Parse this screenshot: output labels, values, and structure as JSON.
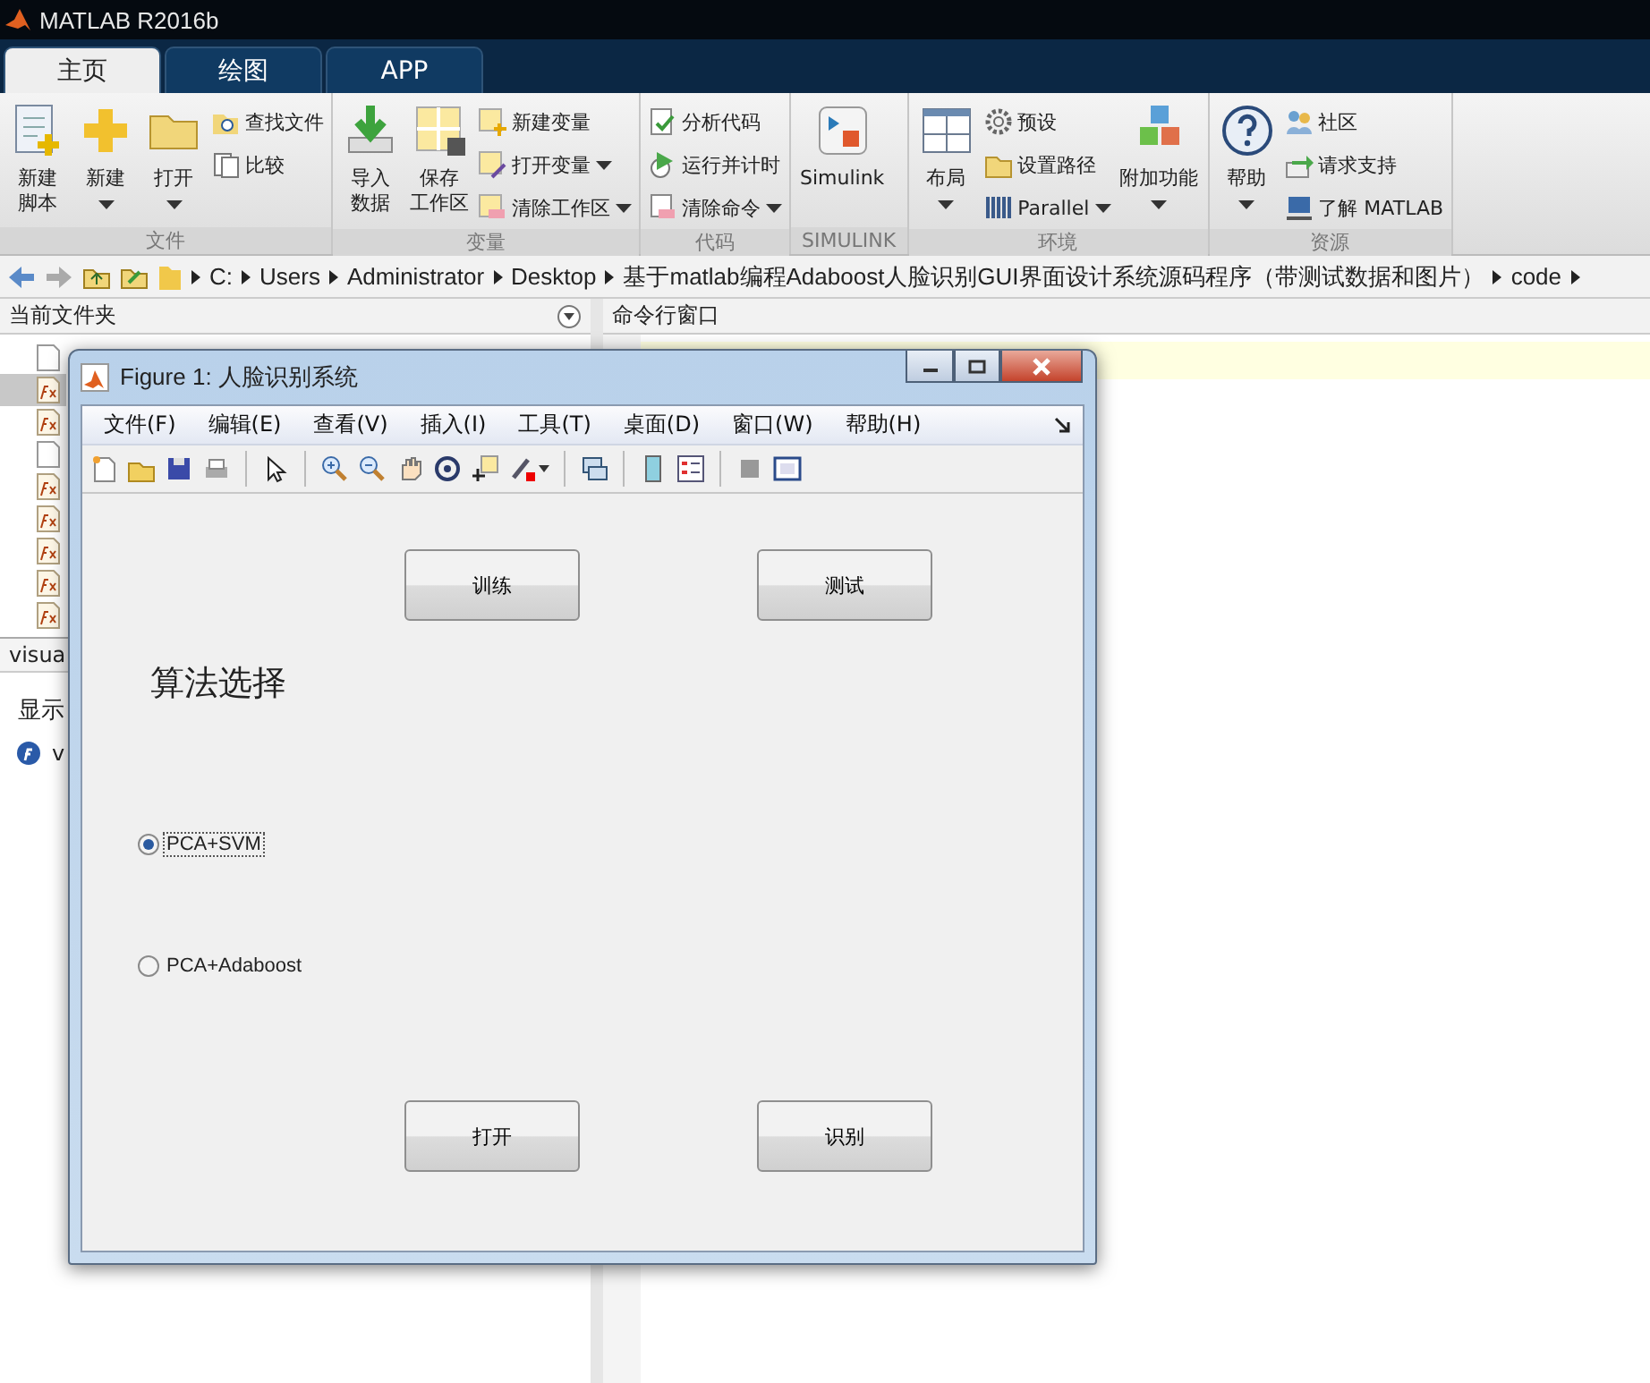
{
  "app": {
    "title": "MATLAB R2016b"
  },
  "tabs": [
    {
      "label": "主页",
      "selected": true
    },
    {
      "label": "绘图",
      "selected": false
    },
    {
      "label": "APP",
      "selected": false
    }
  ],
  "ribbon": {
    "groups": [
      {
        "label": "文件",
        "items": [
          {
            "kind": "large",
            "lines": [
              "新建",
              "脚本"
            ],
            "dropdown": false
          },
          {
            "kind": "large",
            "lines": [
              "新建"
            ],
            "dropdown": true
          },
          {
            "kind": "large",
            "lines": [
              "打开"
            ],
            "dropdown": true
          },
          {
            "kind": "small",
            "label": "查找文件",
            "dropdown": false
          },
          {
            "kind": "small",
            "label": "比较",
            "dropdown": false
          }
        ]
      },
      {
        "label": "变量",
        "items": [
          {
            "kind": "large",
            "lines": [
              "导入",
              "数据"
            ],
            "dropdown": false
          },
          {
            "kind": "large",
            "lines": [
              "保存",
              "工作区"
            ],
            "dropdown": false
          },
          {
            "kind": "small",
            "label": "新建变量",
            "dropdown": false
          },
          {
            "kind": "small",
            "label": "打开变量",
            "dropdown": true
          },
          {
            "kind": "small",
            "label": "清除工作区",
            "dropdown": true
          }
        ]
      },
      {
        "label": "代码",
        "items": [
          {
            "kind": "small",
            "label": "分析代码",
            "dropdown": false
          },
          {
            "kind": "small",
            "label": "运行并计时",
            "dropdown": false
          },
          {
            "kind": "small",
            "label": "清除命令",
            "dropdown": true
          }
        ]
      },
      {
        "label": "SIMULINK",
        "items": [
          {
            "kind": "large",
            "lines": [
              "Simulink"
            ],
            "dropdown": false
          }
        ]
      },
      {
        "label": "环境",
        "items": [
          {
            "kind": "large",
            "lines": [
              "布局"
            ],
            "dropdown": true
          },
          {
            "kind": "small",
            "label": "预设",
            "dropdown": false
          },
          {
            "kind": "small",
            "label": "设置路径",
            "dropdown": false
          },
          {
            "kind": "small",
            "label": "Parallel",
            "dropdown": true
          },
          {
            "kind": "large",
            "lines": [
              "附加功能"
            ],
            "dropdown": true
          }
        ]
      },
      {
        "label": "资源",
        "items": [
          {
            "kind": "large",
            "lines": [
              "帮助"
            ],
            "dropdown": true
          },
          {
            "kind": "small",
            "label": "社区",
            "dropdown": false
          },
          {
            "kind": "small",
            "label": "请求支持",
            "dropdown": false
          },
          {
            "kind": "small",
            "label": "了解 MATLAB",
            "dropdown": false
          }
        ]
      }
    ]
  },
  "address": {
    "crumbs": [
      "C:",
      "Users",
      "Administrator",
      "Desktop",
      "基于matlab编程Adaboost人脸识别GUI界面设计系统源码程序（带测试数据和图片）",
      "code"
    ]
  },
  "current_folder": {
    "title": "当前文件夹",
    "files": [
      {
        "kind": "file",
        "selected": false
      },
      {
        "kind": "function",
        "selected": true
      },
      {
        "kind": "function",
        "selected": false
      },
      {
        "kind": "file",
        "selected": false
      },
      {
        "kind": "function",
        "selected": false
      },
      {
        "kind": "function",
        "selected": false
      },
      {
        "kind": "function",
        "selected": false
      },
      {
        "kind": "function",
        "selected": false
      },
      {
        "kind": "function",
        "selected": false
      }
    ]
  },
  "details": {
    "title": "visua",
    "text": "显示",
    "items": [
      {
        "label": "v"
      }
    ]
  },
  "command_window": {
    "title": "命令行窗口"
  },
  "figure": {
    "title": "Figure 1: 人脸识别系统",
    "menus": [
      "文件(F)",
      "编辑(E)",
      "查看(V)",
      "插入(I)",
      "工具(T)",
      "桌面(D)",
      "窗口(W)",
      "帮助(H)"
    ],
    "top_buttons": [
      "训练",
      "测试"
    ],
    "label": "算法选择",
    "radios": [
      {
        "label": "PCA+SVM",
        "selected": true
      },
      {
        "label": "PCA+Adaboost",
        "selected": false
      }
    ],
    "bottom_buttons": [
      "打开",
      "识别"
    ]
  }
}
